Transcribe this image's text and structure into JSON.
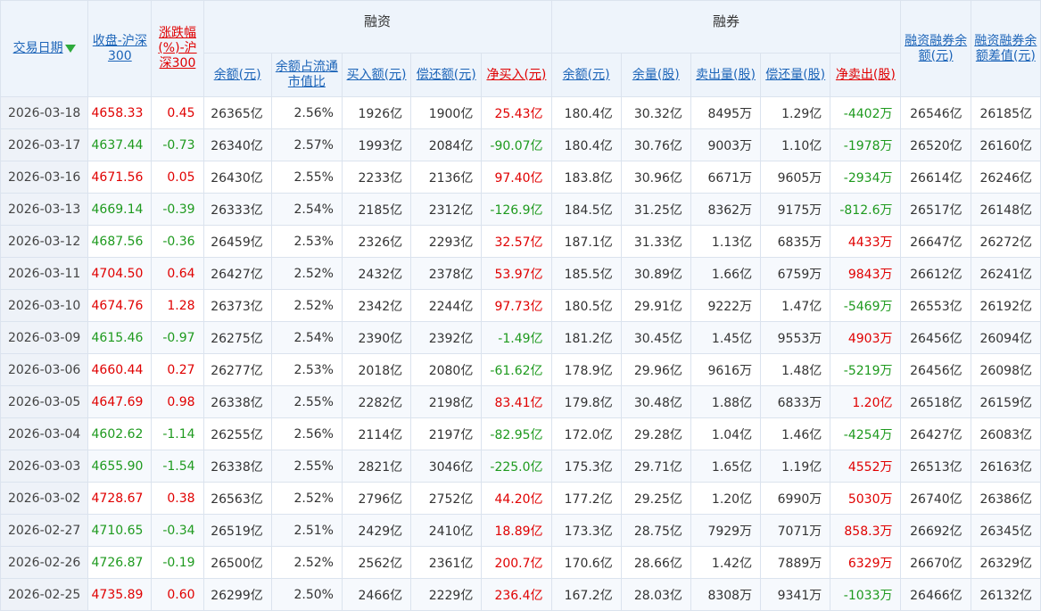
{
  "header": {
    "date": "交易日期",
    "close": "收盘-沪深300",
    "change": "涨跌幅(%)-沪深300",
    "group_rz": "融资",
    "group_rq": "融券",
    "total": "融资融券余额(元)",
    "diff": "融资融券余额差值(元)",
    "rz_cols": [
      "余额(元)",
      "余额占流通市值比",
      "买入额(元)",
      "偿还额(元)",
      "净买入(元)"
    ],
    "rq_cols": [
      "余额(元)",
      "余量(股)",
      "卖出量(股)",
      "偿还量(股)",
      "净卖出(股)"
    ]
  },
  "colors": {
    "up": "#e00000",
    "down": "#1e9a1e",
    "link": "#1c64b8",
    "header_bg": "#eef4fb"
  },
  "rows": [
    {
      "date": "2026-03-18",
      "close": "4658.33",
      "chg": "0.45",
      "rz_bal": "26365亿",
      "rz_ratio": "2.56%",
      "rz_buy": "1926亿",
      "rz_repay": "1900亿",
      "rz_net": "25.43亿",
      "rq_bal": "180.4亿",
      "rq_qty": "30.32亿",
      "rq_sell": "8495万",
      "rq_repay": "1.29亿",
      "rq_net": "-4402万",
      "total": "26546亿",
      "diff": "26185亿"
    },
    {
      "date": "2026-03-17",
      "close": "4637.44",
      "chg": "-0.73",
      "rz_bal": "26340亿",
      "rz_ratio": "2.57%",
      "rz_buy": "1993亿",
      "rz_repay": "2084亿",
      "rz_net": "-90.07亿",
      "rq_bal": "180.4亿",
      "rq_qty": "30.76亿",
      "rq_sell": "9003万",
      "rq_repay": "1.10亿",
      "rq_net": "-1978万",
      "total": "26520亿",
      "diff": "26160亿"
    },
    {
      "date": "2026-03-16",
      "close": "4671.56",
      "chg": "0.05",
      "rz_bal": "26430亿",
      "rz_ratio": "2.55%",
      "rz_buy": "2233亿",
      "rz_repay": "2136亿",
      "rz_net": "97.40亿",
      "rq_bal": "183.8亿",
      "rq_qty": "30.96亿",
      "rq_sell": "6671万",
      "rq_repay": "9605万",
      "rq_net": "-2934万",
      "total": "26614亿",
      "diff": "26246亿"
    },
    {
      "date": "2026-03-13",
      "close": "4669.14",
      "chg": "-0.39",
      "rz_bal": "26333亿",
      "rz_ratio": "2.54%",
      "rz_buy": "2185亿",
      "rz_repay": "2312亿",
      "rz_net": "-126.9亿",
      "rq_bal": "184.5亿",
      "rq_qty": "31.25亿",
      "rq_sell": "8362万",
      "rq_repay": "9175万",
      "rq_net": "-812.6万",
      "total": "26517亿",
      "diff": "26148亿"
    },
    {
      "date": "2026-03-12",
      "close": "4687.56",
      "chg": "-0.36",
      "rz_bal": "26459亿",
      "rz_ratio": "2.53%",
      "rz_buy": "2326亿",
      "rz_repay": "2293亿",
      "rz_net": "32.57亿",
      "rq_bal": "187.1亿",
      "rq_qty": "31.33亿",
      "rq_sell": "1.13亿",
      "rq_repay": "6835万",
      "rq_net": "4433万",
      "total": "26647亿",
      "diff": "26272亿"
    },
    {
      "date": "2026-03-11",
      "close": "4704.50",
      "chg": "0.64",
      "rz_bal": "26427亿",
      "rz_ratio": "2.52%",
      "rz_buy": "2432亿",
      "rz_repay": "2378亿",
      "rz_net": "53.97亿",
      "rq_bal": "185.5亿",
      "rq_qty": "30.89亿",
      "rq_sell": "1.66亿",
      "rq_repay": "6759万",
      "rq_net": "9843万",
      "total": "26612亿",
      "diff": "26241亿"
    },
    {
      "date": "2026-03-10",
      "close": "4674.76",
      "chg": "1.28",
      "rz_bal": "26373亿",
      "rz_ratio": "2.52%",
      "rz_buy": "2342亿",
      "rz_repay": "2244亿",
      "rz_net": "97.73亿",
      "rq_bal": "180.5亿",
      "rq_qty": "29.91亿",
      "rq_sell": "9222万",
      "rq_repay": "1.47亿",
      "rq_net": "-5469万",
      "total": "26553亿",
      "diff": "26192亿"
    },
    {
      "date": "2026-03-09",
      "close": "4615.46",
      "chg": "-0.97",
      "rz_bal": "26275亿",
      "rz_ratio": "2.54%",
      "rz_buy": "2390亿",
      "rz_repay": "2392亿",
      "rz_net": "-1.49亿",
      "rq_bal": "181.2亿",
      "rq_qty": "30.45亿",
      "rq_sell": "1.45亿",
      "rq_repay": "9553万",
      "rq_net": "4903万",
      "total": "26456亿",
      "diff": "26094亿"
    },
    {
      "date": "2026-03-06",
      "close": "4660.44",
      "chg": "0.27",
      "rz_bal": "26277亿",
      "rz_ratio": "2.53%",
      "rz_buy": "2018亿",
      "rz_repay": "2080亿",
      "rz_net": "-61.62亿",
      "rq_bal": "178.9亿",
      "rq_qty": "29.96亿",
      "rq_sell": "9616万",
      "rq_repay": "1.48亿",
      "rq_net": "-5219万",
      "total": "26456亿",
      "diff": "26098亿"
    },
    {
      "date": "2026-03-05",
      "close": "4647.69",
      "chg": "0.98",
      "rz_bal": "26338亿",
      "rz_ratio": "2.55%",
      "rz_buy": "2282亿",
      "rz_repay": "2198亿",
      "rz_net": "83.41亿",
      "rq_bal": "179.8亿",
      "rq_qty": "30.48亿",
      "rq_sell": "1.88亿",
      "rq_repay": "6833万",
      "rq_net": "1.20亿",
      "total": "26518亿",
      "diff": "26159亿"
    },
    {
      "date": "2026-03-04",
      "close": "4602.62",
      "chg": "-1.14",
      "rz_bal": "26255亿",
      "rz_ratio": "2.56%",
      "rz_buy": "2114亿",
      "rz_repay": "2197亿",
      "rz_net": "-82.95亿",
      "rq_bal": "172.0亿",
      "rq_qty": "29.28亿",
      "rq_sell": "1.04亿",
      "rq_repay": "1.46亿",
      "rq_net": "-4254万",
      "total": "26427亿",
      "diff": "26083亿"
    },
    {
      "date": "2026-03-03",
      "close": "4655.90",
      "chg": "-1.54",
      "rz_bal": "26338亿",
      "rz_ratio": "2.55%",
      "rz_buy": "2821亿",
      "rz_repay": "3046亿",
      "rz_net": "-225.0亿",
      "rq_bal": "175.3亿",
      "rq_qty": "29.71亿",
      "rq_sell": "1.65亿",
      "rq_repay": "1.19亿",
      "rq_net": "4552万",
      "total": "26513亿",
      "diff": "26163亿"
    },
    {
      "date": "2026-03-02",
      "close": "4728.67",
      "chg": "0.38",
      "rz_bal": "26563亿",
      "rz_ratio": "2.52%",
      "rz_buy": "2796亿",
      "rz_repay": "2752亿",
      "rz_net": "44.20亿",
      "rq_bal": "177.2亿",
      "rq_qty": "29.25亿",
      "rq_sell": "1.20亿",
      "rq_repay": "6990万",
      "rq_net": "5030万",
      "total": "26740亿",
      "diff": "26386亿"
    },
    {
      "date": "2026-02-27",
      "close": "4710.65",
      "chg": "-0.34",
      "rz_bal": "26519亿",
      "rz_ratio": "2.51%",
      "rz_buy": "2429亿",
      "rz_repay": "2410亿",
      "rz_net": "18.89亿",
      "rq_bal": "173.3亿",
      "rq_qty": "28.75亿",
      "rq_sell": "7929万",
      "rq_repay": "7071万",
      "rq_net": "858.3万",
      "total": "26692亿",
      "diff": "26345亿"
    },
    {
      "date": "2026-02-26",
      "close": "4726.87",
      "chg": "-0.19",
      "rz_bal": "26500亿",
      "rz_ratio": "2.52%",
      "rz_buy": "2562亿",
      "rz_repay": "2361亿",
      "rz_net": "200.7亿",
      "rq_bal": "170.6亿",
      "rq_qty": "28.66亿",
      "rq_sell": "1.42亿",
      "rq_repay": "7889万",
      "rq_net": "6329万",
      "total": "26670亿",
      "diff": "26329亿"
    },
    {
      "date": "2026-02-25",
      "close": "4735.89",
      "chg": "0.60",
      "rz_bal": "26299亿",
      "rz_ratio": "2.50%",
      "rz_buy": "2466亿",
      "rz_repay": "2229亿",
      "rz_net": "236.4亿",
      "rq_bal": "167.2亿",
      "rq_qty": "28.03亿",
      "rq_sell": "8308万",
      "rq_repay": "9341万",
      "rq_net": "-1033万",
      "total": "26466亿",
      "diff": "26132亿"
    }
  ]
}
